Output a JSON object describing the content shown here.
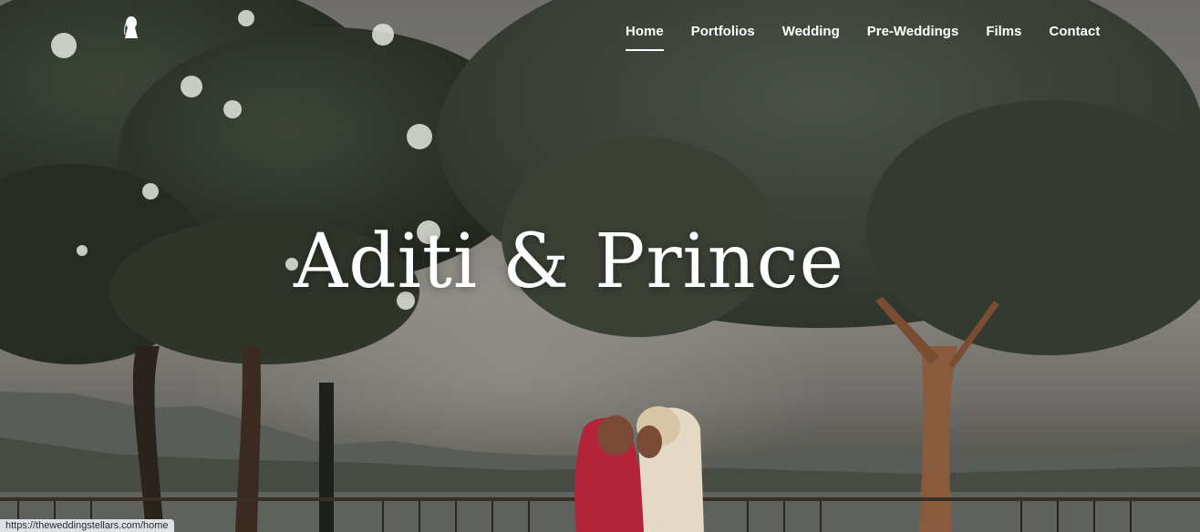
{
  "brand": {
    "logo_icon": "bride-silhouette-logo-icon"
  },
  "nav": {
    "items": [
      {
        "label": "Home",
        "active": true
      },
      {
        "label": "Portfolios",
        "active": false
      },
      {
        "label": "Wedding",
        "active": false
      },
      {
        "label": "Pre-Weddings",
        "active": false
      },
      {
        "label": "Films",
        "active": false
      },
      {
        "label": "Contact",
        "active": false
      }
    ]
  },
  "hero": {
    "title": "Aditi & Prince",
    "image": "wedding-couple-under-trees-lake-background"
  },
  "status_bar": {
    "url": "https://theweddingstellars.com/home"
  },
  "colors": {
    "nav_text": "#ffffff",
    "title_text": "#ffffff",
    "sky": "#7a7874",
    "foliage": "#343a30",
    "saree": "#b3243a",
    "sherwani": "#e4d9c4"
  }
}
